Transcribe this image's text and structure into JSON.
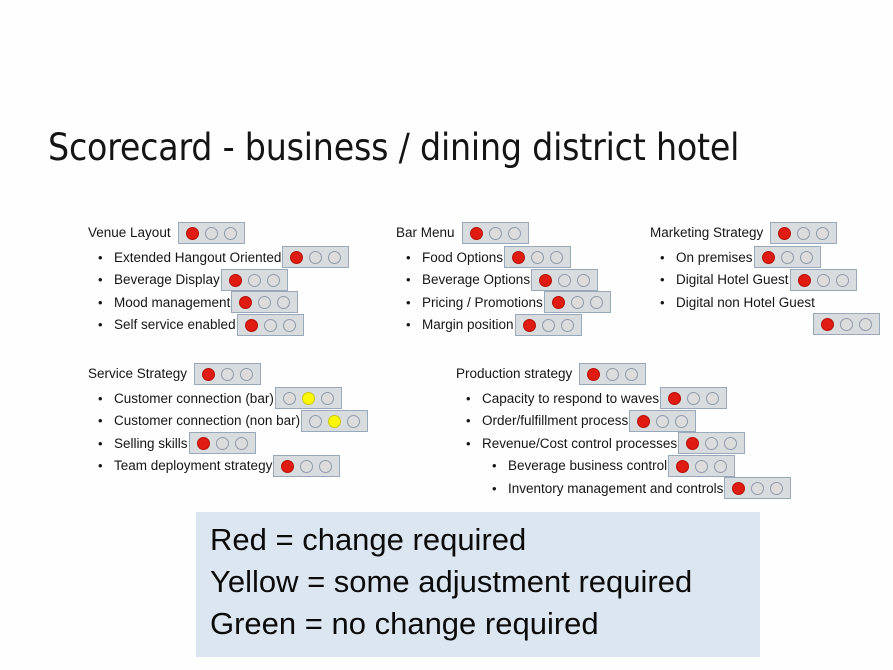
{
  "slide": {
    "title": "Scorecard - business / dining district hotel",
    "background_color": "#fefefe"
  },
  "colors": {
    "red": "#e01b12",
    "yellow": "#fbf705",
    "green": "#1fba26",
    "empty": "#dcdcdc",
    "box_fill": "#d9dcdf",
    "box_border": "#9aa8bb",
    "legend_background": "#dce6f1"
  },
  "sections": [
    {
      "id": "venue-layout",
      "title": "Venue Layout",
      "status": [
        "red",
        "empty",
        "empty"
      ],
      "items": [
        {
          "label": "Extended Hangout Oriented",
          "status": [
            "red",
            "empty",
            "empty"
          ]
        },
        {
          "label": "Beverage Display",
          "status": [
            "red",
            "empty",
            "empty"
          ]
        },
        {
          "label": "Mood management",
          "status": [
            "red",
            "empty",
            "empty"
          ]
        },
        {
          "label": "Self service enabled",
          "status": [
            "red",
            "empty",
            "empty"
          ]
        }
      ]
    },
    {
      "id": "bar-menu",
      "title": "Bar Menu",
      "status": [
        "red",
        "empty",
        "empty"
      ],
      "items": [
        {
          "label": "Food Options",
          "status": [
            "red",
            "empty",
            "empty"
          ]
        },
        {
          "label": "Beverage Options",
          "status": [
            "red",
            "empty",
            "empty"
          ]
        },
        {
          "label": "Pricing / Promotions",
          "status": [
            "red",
            "empty",
            "empty"
          ]
        },
        {
          "label": "Margin position",
          "status": [
            "red",
            "empty",
            "empty"
          ]
        }
      ]
    },
    {
      "id": "marketing-strategy",
      "title": "Marketing Strategy",
      "status": [
        "red",
        "empty",
        "empty"
      ],
      "items": [
        {
          "label": "On premises",
          "status": [
            "red",
            "empty",
            "empty"
          ]
        },
        {
          "label": "Digital Hotel Guest",
          "status": [
            "red",
            "empty",
            "empty"
          ]
        },
        {
          "label": "Digital non Hotel Guest",
          "status": [
            "red",
            "empty",
            "empty"
          ],
          "box_on_next_line": true
        }
      ]
    },
    {
      "id": "service-strategy",
      "title": "Service Strategy",
      "status": [
        "red",
        "empty",
        "empty"
      ],
      "items": [
        {
          "label": "Customer connection (bar)",
          "status": [
            "empty",
            "yellow",
            "empty"
          ]
        },
        {
          "label": "Customer connection (non bar)",
          "status": [
            "empty",
            "yellow",
            "empty"
          ]
        },
        {
          "label": "Selling skills",
          "status": [
            "red",
            "empty",
            "empty"
          ]
        },
        {
          "label": "Team deployment strategy",
          "status": [
            "red",
            "empty",
            "empty"
          ]
        }
      ]
    },
    {
      "id": "production-strategy",
      "title": "Production strategy",
      "status": [
        "red",
        "empty",
        "empty"
      ],
      "items": [
        {
          "label": "Capacity to respond to waves",
          "status": [
            "red",
            "empty",
            "empty"
          ]
        },
        {
          "label": "Order/fulfillment process",
          "status": [
            "red",
            "empty",
            "empty"
          ]
        },
        {
          "label": "Revenue/Cost control processes",
          "status": [
            "red",
            "empty",
            "empty"
          ]
        },
        {
          "label": "Beverage business control",
          "status": [
            "red",
            "empty",
            "empty"
          ],
          "sub": true
        },
        {
          "label": "Inventory management and controls",
          "status": [
            "red",
            "empty",
            "empty"
          ],
          "sub": true
        }
      ]
    }
  ],
  "legend": {
    "lines": [
      "Red = change required",
      "Yellow  = some adjustment required",
      "Green = no change required"
    ]
  },
  "bullet_glyph": "•"
}
